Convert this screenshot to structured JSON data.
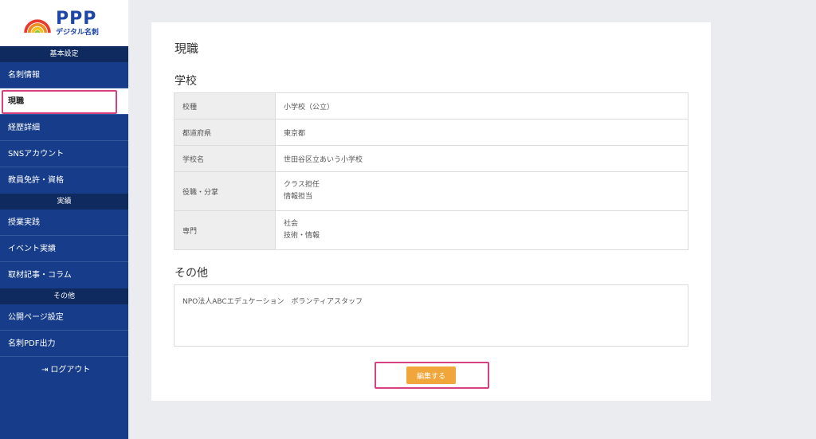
{
  "logo": {
    "brand": "PPP",
    "subtitle": "デジタル名刺"
  },
  "sidebar": {
    "sections": [
      {
        "heading": "基本設定",
        "items": [
          "名刺情報",
          "現職",
          "経歴詳細",
          "SNSアカウント",
          "教員免許・資格"
        ]
      },
      {
        "heading": "実績",
        "items": [
          "授業実践",
          "イベント実績",
          "取材記事・コラム"
        ]
      },
      {
        "heading": "その他",
        "items": [
          "公開ページ設定",
          "名刺PDF出力"
        ]
      }
    ],
    "active_item": "現職",
    "logout_label": "ログアウト"
  },
  "main": {
    "title": "現職",
    "school_section": "学校",
    "rows": [
      {
        "label": "校種",
        "value": [
          "小学校（公立）"
        ]
      },
      {
        "label": "都道府県",
        "value": [
          "東京都"
        ]
      },
      {
        "label": "学校名",
        "value": [
          "世田谷区立あいう小学校"
        ]
      },
      {
        "label": "役職・分掌",
        "value": [
          "クラス担任",
          "情報担当"
        ]
      },
      {
        "label": "専門",
        "value": [
          "社会",
          "技術・情報"
        ]
      }
    ],
    "other_section": "その他",
    "other_text": "NPO法人ABCエデュケーション　ボランティアスタッフ",
    "edit_button": "編集する"
  },
  "colors": {
    "sidebar": "#173d8a",
    "section_head": "#0f2a5f",
    "accent": "#f0a63b",
    "highlight": "#d6427f"
  }
}
